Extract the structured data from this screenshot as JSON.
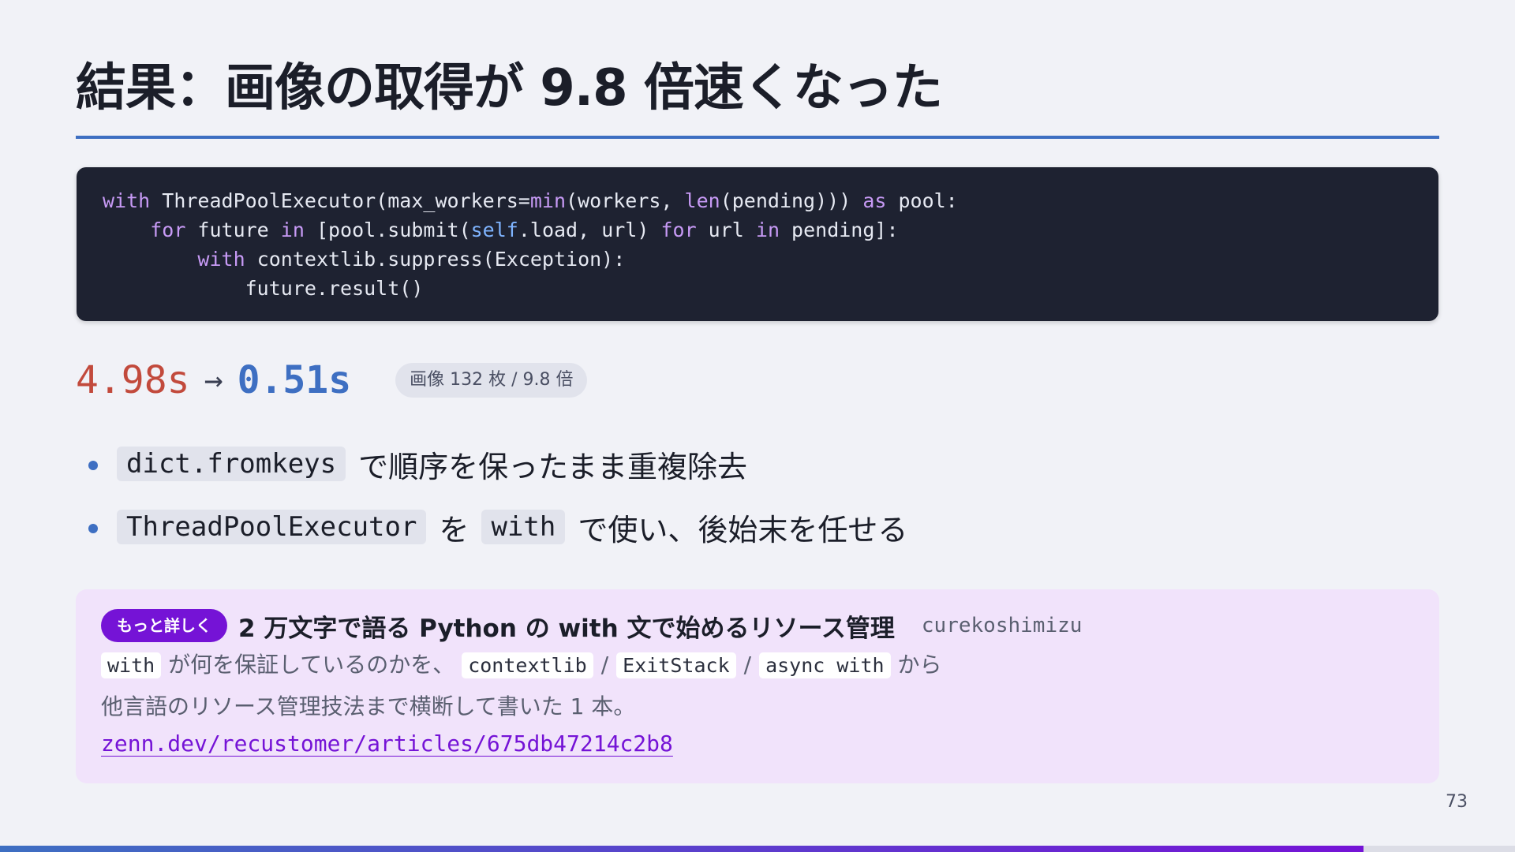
{
  "slide": {
    "title": "結果：画像の取得が 9.8 倍速くなった",
    "page_number": "73",
    "progress_fraction": 0.9
  },
  "code": [
    [
      {
        "t": "with",
        "c": "kw"
      },
      {
        "t": " ThreadPoolExecutor(max_workers="
      },
      {
        "t": "min",
        "c": "fn"
      },
      {
        "t": "(workers, "
      },
      {
        "t": "len",
        "c": "fn"
      },
      {
        "t": "(pending))) "
      },
      {
        "t": "as",
        "c": "kw"
      },
      {
        "t": " pool:"
      }
    ],
    [
      {
        "t": "    "
      },
      {
        "t": "for",
        "c": "kw"
      },
      {
        "t": " future "
      },
      {
        "t": "in",
        "c": "kw"
      },
      {
        "t": " [pool.submit("
      },
      {
        "t": "self",
        "c": "self"
      },
      {
        "t": ".load, url) "
      },
      {
        "t": "for",
        "c": "kw"
      },
      {
        "t": " url "
      },
      {
        "t": "in",
        "c": "kw"
      },
      {
        "t": " pending]:"
      }
    ],
    [
      {
        "t": "        "
      },
      {
        "t": "with",
        "c": "kw"
      },
      {
        "t": " contextlib.suppress(Exception):"
      }
    ],
    [
      {
        "t": "            future.result()"
      }
    ]
  ],
  "metric": {
    "before": "4.98s",
    "arrow": "→",
    "after": "0.51s",
    "badge": "画像 132 枚 / 9.8 倍"
  },
  "bullets": [
    {
      "code": "dict.fromkeys",
      "text": "で順序を保ったまま重複除去"
    },
    {
      "code": "ThreadPoolExecutor",
      "mid": "を",
      "code2": "with",
      "text": "で使い、後始末を任せる"
    }
  ],
  "card": {
    "badge": "もっと詳しく",
    "title": "2 万文字で語る Python の with 文で始めるリソース管理",
    "author": "curekoshimizu",
    "code_with": "with",
    "line1_text_a": "が何を保証しているのかを、",
    "code_contextlib": "contextlib",
    "slash": "/",
    "code_exitstack": "ExitStack",
    "code_asyncwith": "async with",
    "line1_text_b": "から",
    "line2": "他言語のリソース管理技法まで横断して書いた 1 本。",
    "link": "zenn.dev/recustomer/articles/675db47214c2b8"
  },
  "colors": {
    "accent_blue": "#3e6fc2",
    "accent_purple": "#7513d6",
    "metric_before_red": "#c24a3c",
    "code_bg": "#1e2231"
  }
}
